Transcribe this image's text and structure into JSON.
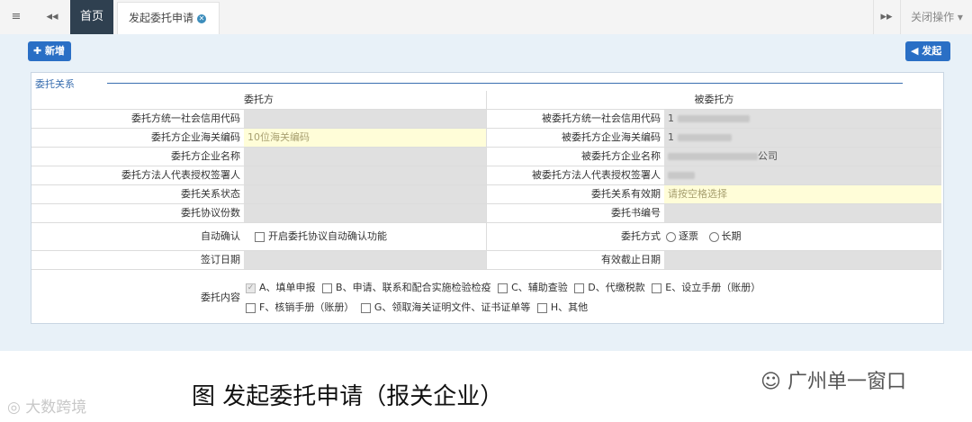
{
  "topbar": {
    "menu_icon": "hamburger-icon",
    "prev_icon": "double-left-arrow-icon",
    "next_icon": "double-right-arrow-icon",
    "home_tab": "首页",
    "active_tab": "发起委托申请",
    "close_ops": "关闭操作"
  },
  "toolbar": {
    "add_label": "新增",
    "submit_label": "发起"
  },
  "panel": {
    "legend": "委托关系",
    "head_left": "委托方",
    "head_right": "被委托方",
    "rows": [
      {
        "l_label": "委托方统一社会信用代码",
        "l_value": "",
        "r_label": "被委托方统一社会信用代码",
        "r_value": "1"
      },
      {
        "l_label": "委托方企业海关编码",
        "l_value": "10位海关编码",
        "r_label": "被委托方企业海关编码",
        "r_value": "1"
      },
      {
        "l_label": "委托方企业名称",
        "l_value": "",
        "r_label": "被委托方企业名称",
        "r_value": "公司"
      },
      {
        "l_label": "委托方法人代表授权签署人",
        "l_value": "",
        "r_label": "被委托方法人代表授权签署人",
        "r_value": ""
      },
      {
        "l_label": "委托关系状态",
        "l_value": "",
        "r_label": "委托关系有效期",
        "r_value": "请按空格选择"
      },
      {
        "l_label": "委托协议份数",
        "l_value": "",
        "r_label": "委托书编号",
        "r_value": ""
      }
    ],
    "auto_confirm_label": "自动确认",
    "auto_confirm_text": "开启委托协议自动确认功能",
    "method_label": "委托方式",
    "method_opt1": "逐票",
    "method_opt2": "长期",
    "sign_date_label": "签订日期",
    "expire_date_label": "有效截止日期",
    "content_label": "委托内容",
    "content_a": "A、填单申报",
    "content_b": "B、申请、联系和配合实施检验检疫",
    "content_c": "C、辅助查验",
    "content_d": "D、代缴税款",
    "content_e": "E、设立手册（账册）",
    "content_f": "F、核销手册（账册）",
    "content_g": "G、领取海关证明文件、证书证单等",
    "content_h": "H、其他"
  },
  "caption": "图  发起委托申请（报关企业）",
  "watermark_right": "广州单一窗口",
  "watermark_left": "大数跨境"
}
